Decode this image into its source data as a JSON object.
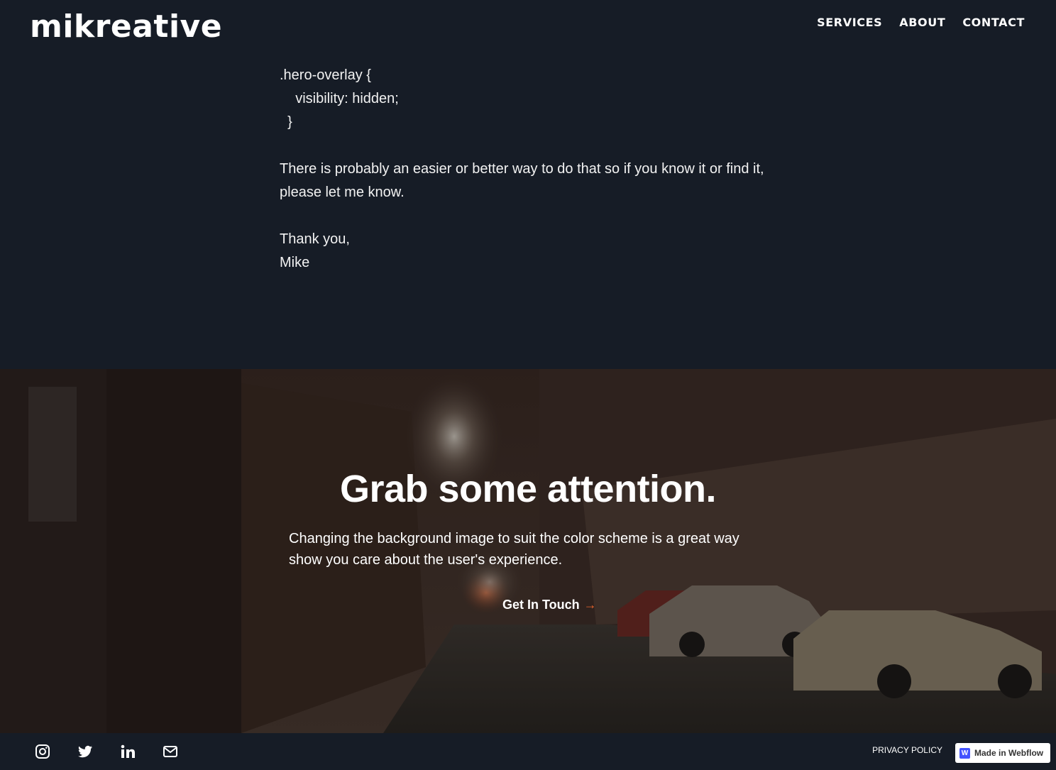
{
  "header": {
    "logo": "mikreative",
    "nav": [
      "SERVICES",
      "ABOUT",
      "CONTACT"
    ]
  },
  "article": {
    "code": [
      ".hero-overlay {",
      "    visibility: hidden;",
      "  }"
    ],
    "paragraph": "There is probably an easier or better way to do that so if you know it or find it, please let me know.",
    "signoff": "Thank you,",
    "name": "Mike"
  },
  "hero": {
    "title": "Grab some attention.",
    "text": "Changing the background image to suit the color scheme is a great way show you care about the user's experience.",
    "cta": "Get In Touch",
    "cta_arrow": "→"
  },
  "footer": {
    "social_icons": [
      "instagram-icon",
      "twitter-icon",
      "linkedin-icon",
      "mail-icon"
    ],
    "privacy": "PRIVACY POLICY",
    "badge": "Made in Webflow",
    "badge_mark": "W"
  },
  "colors": {
    "background": "#161c26",
    "accent": "#e8642c",
    "webflow": "#4353ff"
  }
}
